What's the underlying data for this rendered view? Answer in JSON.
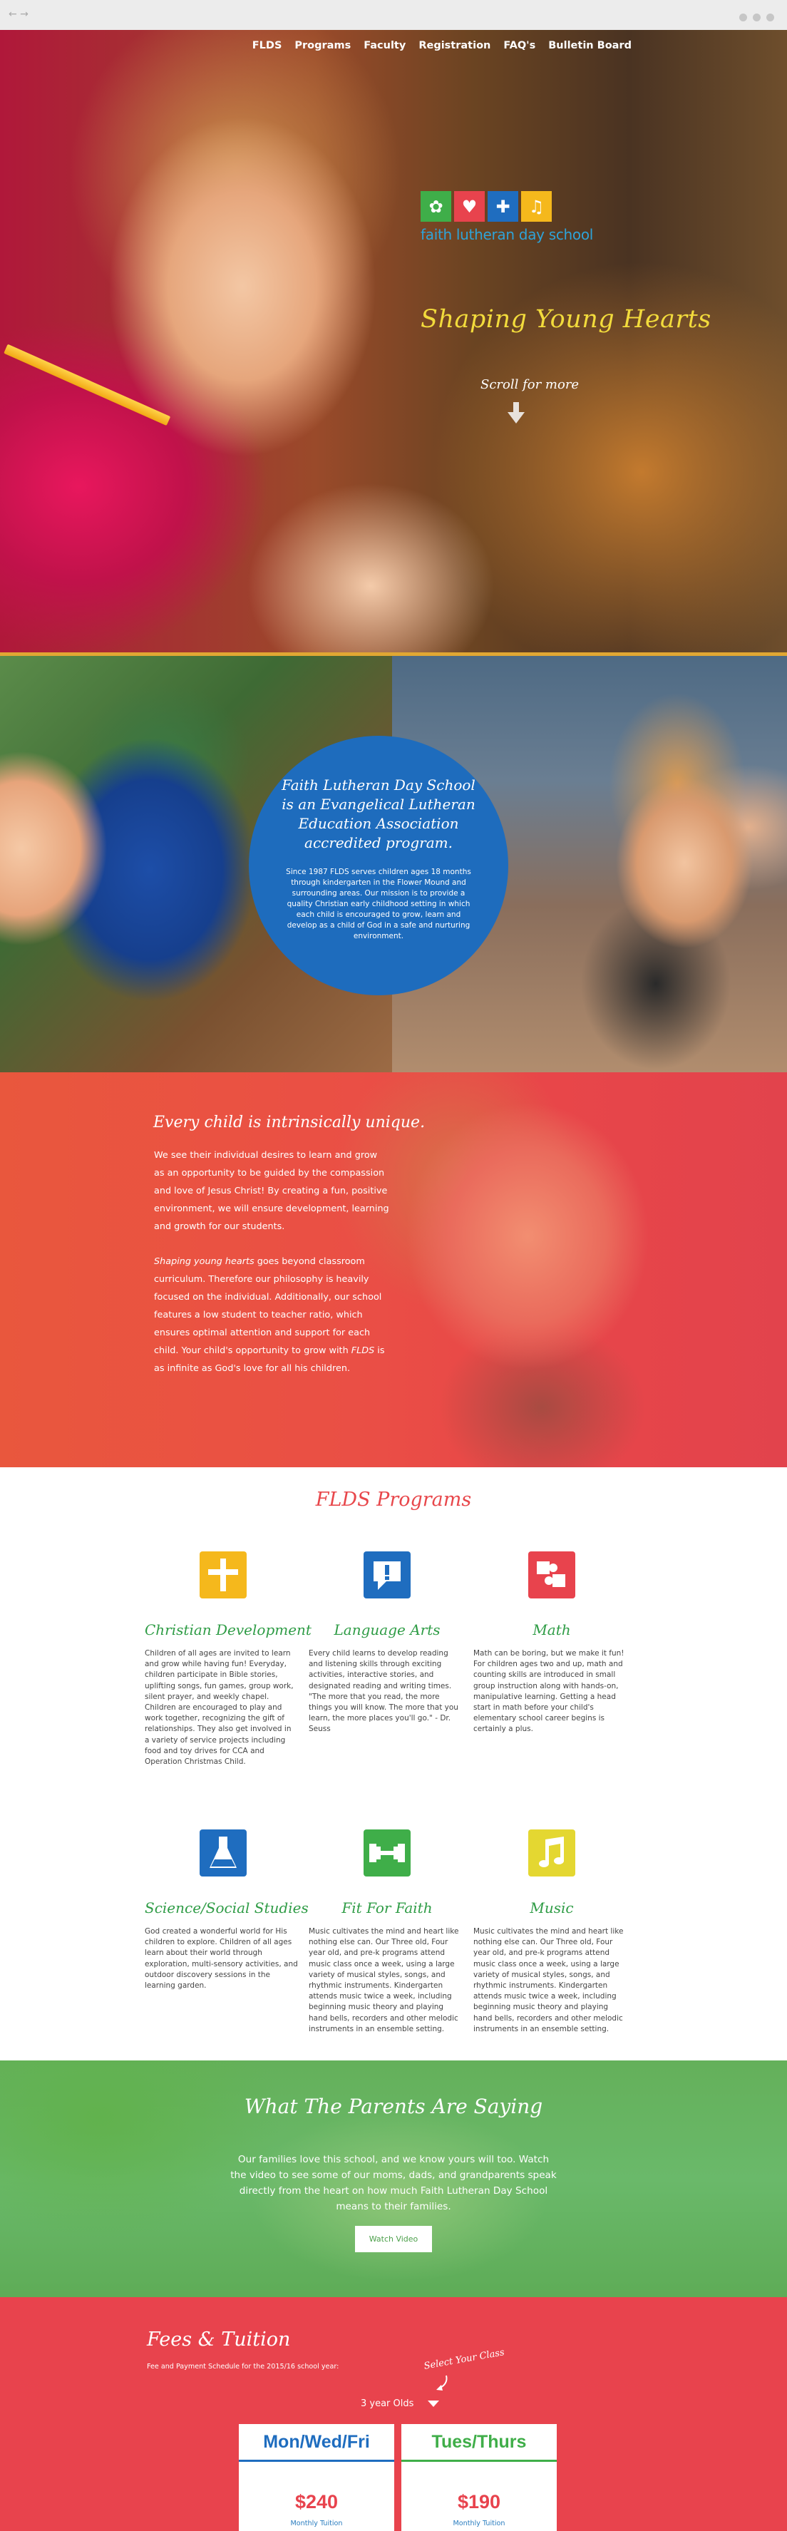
{
  "browser": {
    "nav_arrows": "← →"
  },
  "nav": {
    "items": [
      "FLDS",
      "Programs",
      "Faculty",
      "Registration",
      "FAQ's",
      "Bulletin Board"
    ]
  },
  "hero": {
    "logo_text": "faith lutheran day school",
    "tagline": "Shaping Young Hearts",
    "scroll_label": "Scroll for more"
  },
  "accreditation": {
    "heading": "Faith Lutheran Day School is an Evangelical Lutheran Education Association accredited program.",
    "body": "Since 1987 FLDS serves children ages 18 months through kindergarten in the Flower Mound and surrounding areas. Our mission is to provide a quality Christian early childhood setting in which each child is encouraged to grow, learn and develop as a child of God in a safe and nurturing environment."
  },
  "unique": {
    "heading": "Every child is intrinsically unique.",
    "p1": "We see their individual desires to learn and grow as an opportunity to be guided by the compassion and love of Jesus Christ! By creating a fun, positive environment, we will ensure development, learning and growth for our students.",
    "p2_em1": "Shaping young hearts",
    "p2_part1": " goes beyond classroom curriculum. Therefore our philosophy is heavily focused on the individual. Additionally, our school features a low student to teacher ratio, which ensures optimal attention and support for each child. Your child's opportunity to grow with ",
    "p2_em2": "FLDS",
    "p2_part2": " is as infinite as God's love for all his children."
  },
  "programs": {
    "title": "FLDS Programs",
    "items": [
      {
        "name": "Christian Development",
        "icon": "cross-icon",
        "color": "#f5b81c",
        "desc": "Children of all ages are invited to learn and grow while having fun! Everyday, children participate in Bible stories, uplifting songs, fun games, group work, silent prayer, and weekly chapel. Children are encouraged to play and work together, recognizing the gift of relationships. They also get involved in a variety of service projects including food and toy drives for CCA and Operation Christmas Child."
      },
      {
        "name": "Language Arts",
        "icon": "speech-bubble-icon",
        "color": "#1f6dbf",
        "desc": "Every child learns to develop reading and listening skills through exciting activities, interactive stories, and designated reading and writing times. \"The more that you read, the more things you will know. The more that you learn, the more places you'll go.\" - Dr. Seuss"
      },
      {
        "name": "Math",
        "icon": "puzzle-icon",
        "color": "#e8434d",
        "desc": "Math can be boring, but we make it fun! For children ages two and up, math and counting skills are introduced in small group instruction along with hands-on, manipulative learning. Getting a head start in math before your child's elementary school career begins is certainly a plus."
      },
      {
        "name": "Science/Social Studies",
        "icon": "flask-icon",
        "color": "#1f6dbf",
        "desc": "God created a wonderful world for His children to explore. Children of all ages learn about their world through exploration, multi-sensory activities, and outdoor discovery sessions in the learning garden."
      },
      {
        "name": "Fit For Faith",
        "icon": "dumbbell-icon",
        "color": "#3fae49",
        "desc": "Music cultivates the mind and heart like nothing else can. Our Three old, Four year old, and pre-k programs attend music class once a week, using a large variety of musical styles, songs, and rhythmic instruments. Kindergarten attends music twice a week, including beginning music theory and playing hand bells, recorders and other melodic instruments in an ensemble setting."
      },
      {
        "name": "Music",
        "icon": "music-note-icon",
        "color": "#e4d731",
        "desc": "Music cultivates the mind and heart like nothing else can. Our Three old, Four year old, and pre-k programs attend music class once a week, using a large variety of musical styles, songs, and rhythmic instruments. Kindergarten attends music twice a week, including beginning music theory and playing hand bells, recorders and other melodic instruments in an ensemble setting."
      }
    ]
  },
  "parents": {
    "heading": "What The Parents Are Saying",
    "body": "Our families love this school, and we know yours will too. Watch the video to see some of our moms, dads, and grandparents speak directly from the heart on how much Faith Lutheran Day School means to their families.",
    "button": "Watch Video"
  },
  "fees": {
    "heading": "Fees & Tuition",
    "subheading": "Fee and Payment Schedule for the 2015/16 school year:",
    "select_hint": "Select Your Class",
    "selected_class": "3 year Olds",
    "cards": [
      {
        "title": "Mon/Wed/Fri",
        "price": "$240",
        "label": "Monthly Tuition",
        "color": "#1f6dbf"
      },
      {
        "title": "Tues/Thurs",
        "price": "$190",
        "label": "Monthly Tuition",
        "color": "#3fae49"
      }
    ]
  }
}
